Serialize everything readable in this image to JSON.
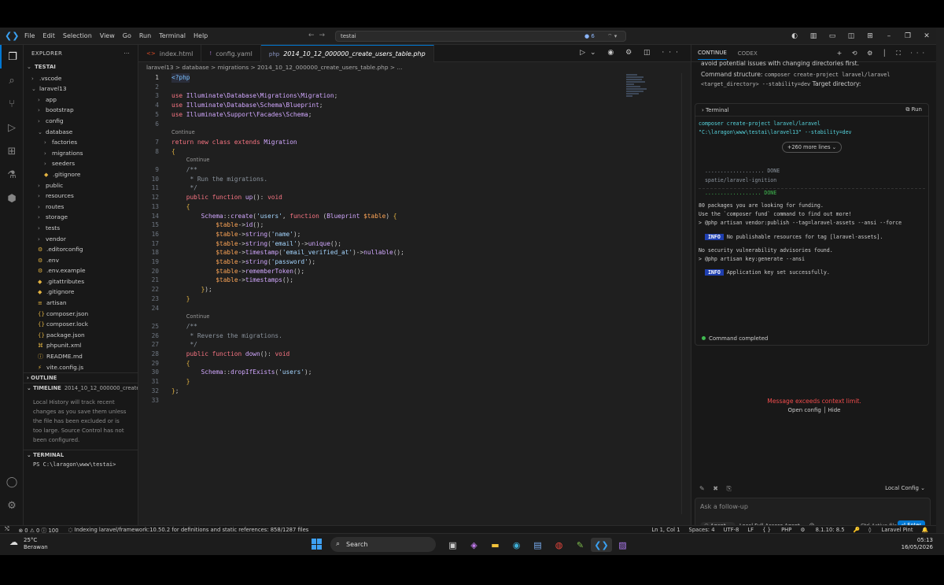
{
  "titlebar": {
    "menu": [
      "File",
      "Edit",
      "Selection",
      "View",
      "Go",
      "Run",
      "Terminal",
      "Help"
    ],
    "search": "testai",
    "badge_count": "6"
  },
  "explorer": {
    "title": "EXPLORER",
    "root": "TESTAI",
    "items": [
      {
        "label": ".vscode",
        "indent": 1,
        "type": "folder",
        "open": false
      },
      {
        "label": "laravel13",
        "indent": 1,
        "type": "folder",
        "open": true
      },
      {
        "label": "app",
        "indent": 2,
        "type": "folder",
        "open": false
      },
      {
        "label": "bootstrap",
        "indent": 2,
        "type": "folder",
        "open": false
      },
      {
        "label": "config",
        "indent": 2,
        "type": "folder",
        "open": false
      },
      {
        "label": "database",
        "indent": 2,
        "type": "folder",
        "open": true
      },
      {
        "label": "factories",
        "indent": 3,
        "type": "folder",
        "open": false
      },
      {
        "label": "migrations",
        "indent": 3,
        "type": "folder",
        "open": false
      },
      {
        "label": "seeders",
        "indent": 3,
        "type": "folder",
        "open": false
      },
      {
        "label": ".gitignore",
        "indent": 3,
        "type": "file",
        "icon": "◆"
      },
      {
        "label": "public",
        "indent": 2,
        "type": "folder",
        "open": false
      },
      {
        "label": "resources",
        "indent": 2,
        "type": "folder",
        "open": false
      },
      {
        "label": "routes",
        "indent": 2,
        "type": "folder",
        "open": false
      },
      {
        "label": "storage",
        "indent": 2,
        "type": "folder",
        "open": false
      },
      {
        "label": "tests",
        "indent": 2,
        "type": "folder",
        "open": false
      },
      {
        "label": "vendor",
        "indent": 2,
        "type": "folder",
        "open": false
      },
      {
        "label": ".editorconfig",
        "indent": 2,
        "type": "file",
        "icon": "⚙"
      },
      {
        "label": ".env",
        "indent": 2,
        "type": "file",
        "icon": "⚙"
      },
      {
        "label": ".env.example",
        "indent": 2,
        "type": "file",
        "icon": "⚙"
      },
      {
        "label": ".gitattributes",
        "indent": 2,
        "type": "file",
        "icon": "◆"
      },
      {
        "label": ".gitignore",
        "indent": 2,
        "type": "file",
        "icon": "◆"
      },
      {
        "label": "artisan",
        "indent": 2,
        "type": "file",
        "icon": "≡"
      },
      {
        "label": "composer.json",
        "indent": 2,
        "type": "file",
        "icon": "{}"
      },
      {
        "label": "composer.lock",
        "indent": 2,
        "type": "file",
        "icon": "{}"
      },
      {
        "label": "package.json",
        "indent": 2,
        "type": "file",
        "icon": "{}"
      },
      {
        "label": "phpunit.xml",
        "indent": 2,
        "type": "file",
        "icon": "⌘"
      },
      {
        "label": "README.md",
        "indent": 2,
        "type": "file",
        "icon": "ⓘ"
      },
      {
        "label": "vite.config.js",
        "indent": 2,
        "type": "file",
        "icon": "⚡"
      }
    ],
    "outline_label": "OUTLINE",
    "timeline_label": "TIMELINE",
    "timeline_file": "2014_10_12_000000_create_us...",
    "timeline_text": "Local History will track recent changes as you save them unless the file has been excluded or is too large. Source Control has not been configured.",
    "terminal_label": "TERMINAL",
    "terminal_prompt": "PS C:\\laragon\\www\\testai>"
  },
  "editor": {
    "tabs": [
      {
        "label": "index.html",
        "icon": "<>",
        "active": false
      },
      {
        "label": "config.yaml",
        "icon": "!",
        "active": false
      },
      {
        "label": "2014_10_12_000000_create_users_table.php",
        "icon": "php",
        "active": true
      }
    ],
    "breadcrumb": "laravel13 > database > migrations > 2014_10_12_000000_create_users_table.php > ...",
    "lens_label": "Continue"
  },
  "chat": {
    "tabs": [
      "CONTINUE",
      "CODEX"
    ],
    "text_top": "avoid potential issues with changing directories first.",
    "structure_label": "Command structure:",
    "structure_cmd": "composer create-project laravel/laravel <target_directory> --stability=dev",
    "target_label": "Target directory:",
    "terminal_title": "Terminal",
    "run_label": "Run",
    "cmd_line1": "composer create-project laravel/laravel",
    "cmd_line2": "\"C:\\laragon\\www\\testai\\laravel13\" --stability=dev",
    "more_lines": "+260 more lines",
    "out_done1": "  ................... DONE",
    "out_pkg": "  spatie/laravel-ignition",
    "out_done2": "  .................. DONE",
    "out_funding1": "80 packages you are looking for funding.",
    "out_funding2": "Use the `composer fund` command to find out more!",
    "out_publish": "> @php artisan vendor:publish --tag=laravel-assets --ansi --force",
    "info_tag": "INFO",
    "out_info1": "No publishable resources for tag [laravel-assets].",
    "out_novuln": "No security vulnerability advisories found.",
    "out_keygen": "> @php artisan key:generate --ansi",
    "out_info2": "Application key set successfully.",
    "completed": "Command completed",
    "error": "Message exceeds context limit.",
    "open_config": "Open config",
    "hide": "Hide",
    "local_config": "Local Config",
    "input_placeholder": "Ask a follow-up",
    "agent_label": "Agent",
    "access_label": "Local Full Access Agent",
    "ctrl_active": "Ctrl Active file",
    "enter_label": "Enter"
  },
  "statusbar": {
    "problems": "⊗ 0 ⚠ 0 ⓘ 100",
    "indexing": "Indexing laravel/framework:10.50.2 for definitions and static references: 858/1287 files",
    "position": "Ln 1, Col 1",
    "spaces": "Spaces: 4",
    "encoding": "UTF-8",
    "eol": "LF",
    "language": "PHP",
    "php_version": "8.1.10: 8.5",
    "pint": "Laravel Pint"
  },
  "taskbar": {
    "temperature": "25°C",
    "weather": "Berawan",
    "search": "Search",
    "time": "05:13",
    "date": "16/05/2026"
  }
}
